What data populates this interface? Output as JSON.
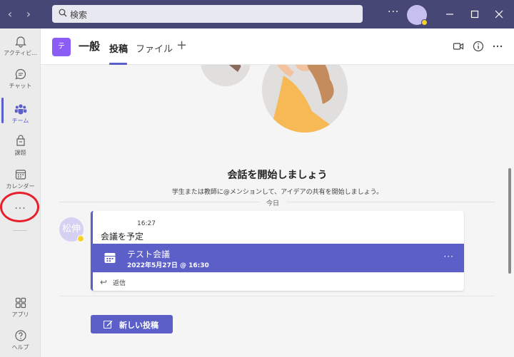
{
  "titlebar": {
    "search_placeholder": "検索",
    "more": "···"
  },
  "rail": {
    "items": [
      {
        "label": "アクティビ...",
        "icon": "bell-icon"
      },
      {
        "label": "チャット",
        "icon": "chat-icon"
      },
      {
        "label": "チーム",
        "icon": "teams-icon"
      },
      {
        "label": "課題",
        "icon": "assignments-icon"
      },
      {
        "label": "カレンダー",
        "icon": "calendar-icon"
      },
      {
        "label": "アプリ",
        "icon": "apps-icon"
      },
      {
        "label": "ヘルプ",
        "icon": "help-icon"
      }
    ],
    "more": "···"
  },
  "header": {
    "team_initial": "テ",
    "channel_name": "一般",
    "tabs": [
      "投稿",
      "ファイル"
    ],
    "add_tab": "+"
  },
  "main": {
    "empty_title": "会話を開始しましょう",
    "empty_subtitle": "学生または教師に@メンションして、アイデアの共有を開始しましょう。",
    "date_divider": "今日",
    "message": {
      "avatar_text": "松伸",
      "time": "16:27",
      "text": "会議を予定",
      "meeting_title": "テスト会議",
      "meeting_date": "2022年5月27日 @ 16:30",
      "reply_label": "返信"
    },
    "new_post_label": "新しい投稿"
  },
  "colors": {
    "titlebar": "#464775",
    "accent": "#5b5fc7",
    "annotation": "#e8202b"
  }
}
